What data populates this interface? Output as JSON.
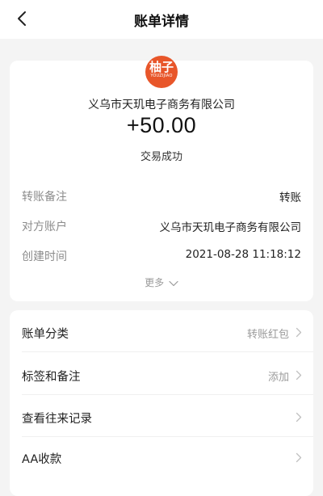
{
  "header": {
    "title": "账单详情"
  },
  "transaction": {
    "logo": {
      "main": "柚子",
      "sub": "YOUZIJIAO"
    },
    "merchant_name": "义乌市天玑电子商务有限公司",
    "amount": "+50.00",
    "status": "交易成功",
    "details": [
      {
        "label": "转账备注",
        "value": "转账"
      },
      {
        "label": "对方账户",
        "value": "义乌市天玑电子商务有限公司"
      },
      {
        "label": "创建时间",
        "value": "2021-08-28 11:18:12"
      }
    ],
    "more_label": "更多"
  },
  "menu": [
    {
      "label": "账单分类",
      "value": "转账红包"
    },
    {
      "label": "标签和备注",
      "value": "添加"
    },
    {
      "label": "查看往来记录",
      "value": ""
    },
    {
      "label": "AA收款",
      "value": ""
    }
  ],
  "colors": {
    "page_background": "#f4f4f4",
    "card_background": "#ffffff",
    "logo_orange": "#e8562a",
    "label_gray": "#8c8c8c",
    "chevron_gray": "#c0c0c0"
  },
  "icons": {
    "back": "chevron-left-icon",
    "more": "chevron-down-icon",
    "menu_arrow": "chevron-right-icon"
  }
}
